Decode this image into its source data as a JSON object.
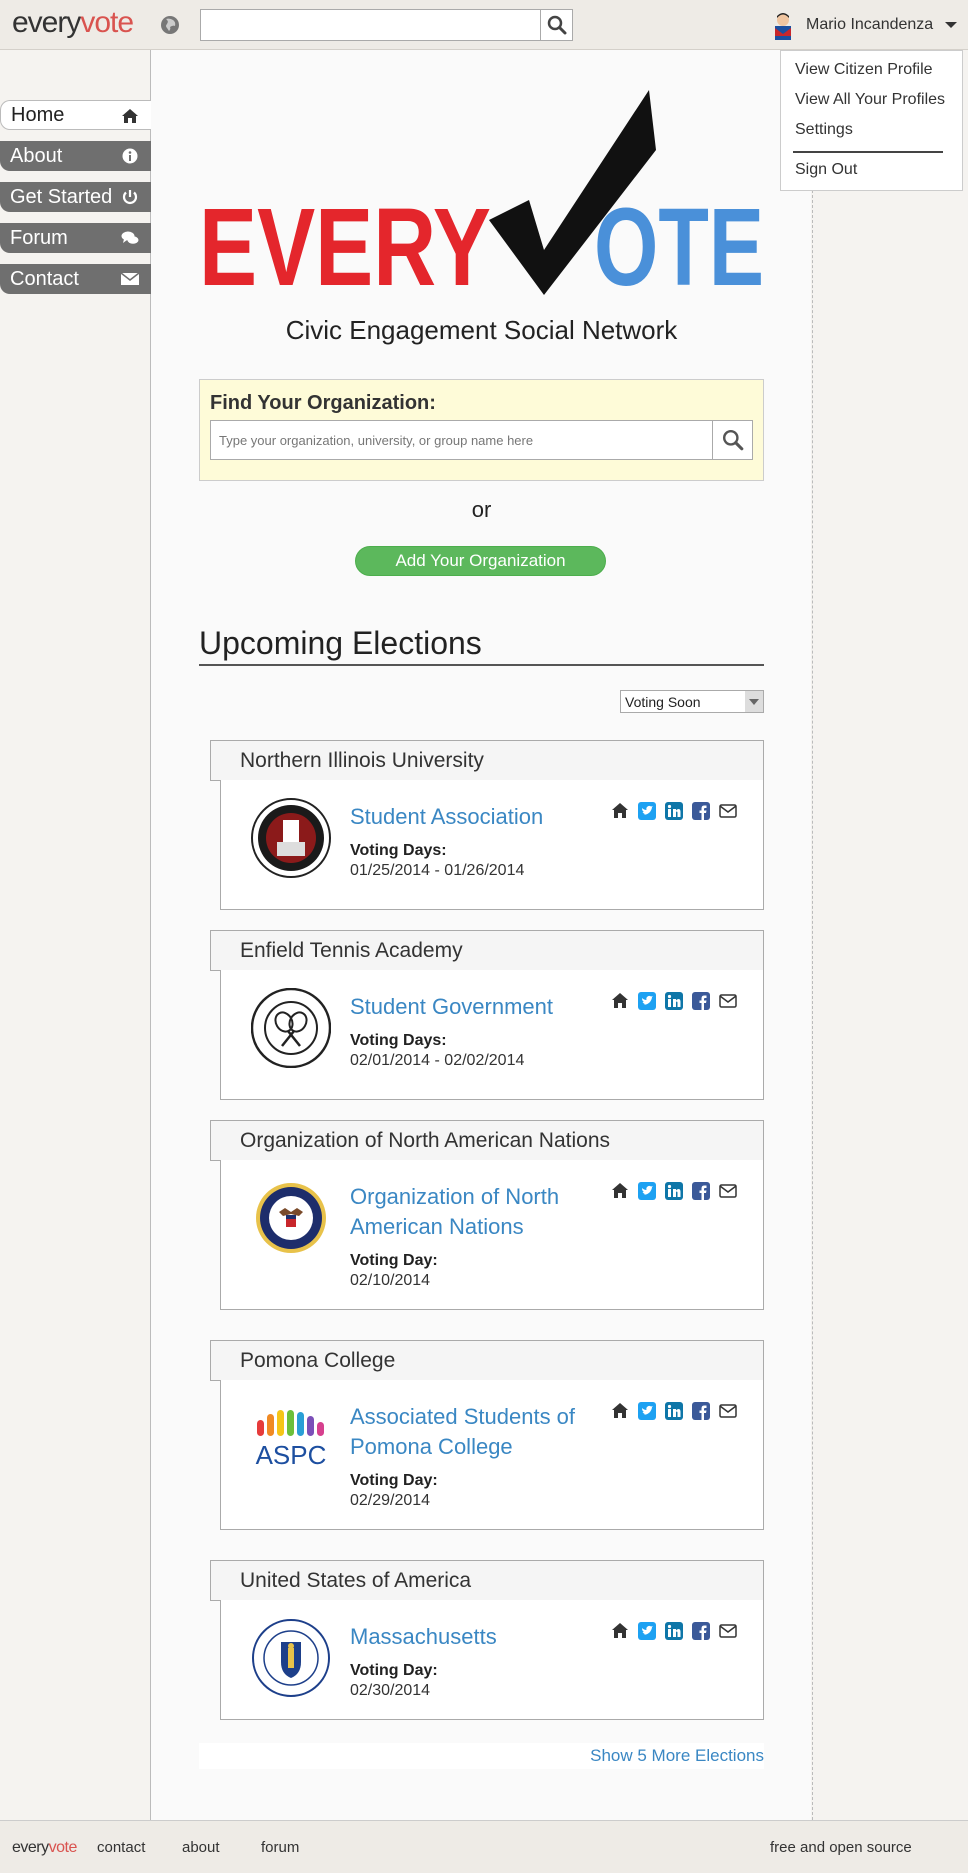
{
  "header": {
    "brand_part1": "every",
    "brand_part2": "vote",
    "user_name": "Mario Incandenza"
  },
  "user_menu": {
    "items": [
      "View Citizen Profile",
      "View All Your Profiles",
      "Settings",
      "Sign Out"
    ]
  },
  "sidebar": {
    "items": [
      {
        "label": "Home",
        "icon": "home-icon"
      },
      {
        "label": "About",
        "icon": "info-icon"
      },
      {
        "label": "Get Started",
        "icon": "power-icon"
      },
      {
        "label": "Forum",
        "icon": "comments-icon"
      },
      {
        "label": "Contact",
        "icon": "envelope-icon"
      }
    ]
  },
  "main": {
    "tagline": "Civic Engagement Social Network",
    "find_label": "Find Your Organization:",
    "find_placeholder": "Type your organization, university, or group name here",
    "or_text": "or",
    "add_button": "Add Your Organization",
    "upcoming_title": "Upcoming Elections",
    "sort_selected": "Voting Soon",
    "more_link": "Show 5 More Elections"
  },
  "elections": [
    {
      "org": "Northern Illinois University",
      "name": "Student Association",
      "voting_label": "Voting Days:",
      "dates": "01/25/2014 - 01/26/2014"
    },
    {
      "org": "Enfield Tennis Academy",
      "name": "Student Government",
      "voting_label": "Voting Days:",
      "dates": "02/01/2014 - 02/02/2014"
    },
    {
      "org": "Organization of North American Nations",
      "name": "Organization of North American Nations",
      "voting_label": "Voting Day:",
      "dates": "02/10/2014"
    },
    {
      "org": "Pomona College",
      "name": "Associated Students of Pomona College",
      "voting_label": "Voting Day:",
      "dates": "02/29/2014"
    },
    {
      "org": "United States of America",
      "name": "Massachusetts",
      "voting_label": "Voting Day:",
      "dates": "02/30/2014"
    }
  ],
  "footer": {
    "brand_part1": "every",
    "brand_part2": "vote",
    "links": [
      "contact",
      "about",
      "forum"
    ],
    "right_text": "free and open source"
  },
  "colors": {
    "accent_red": "#d9534f",
    "link_blue": "#3a87c3",
    "add_green": "#5cb85c",
    "twitter_blue": "#1da1f2",
    "linkedin_blue": "#0e76a8",
    "facebook_blue": "#3b5998"
  }
}
